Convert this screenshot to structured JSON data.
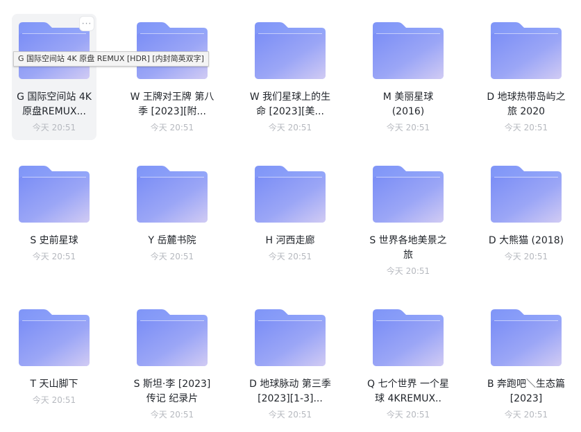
{
  "tooltip": "G 国际空间站 4K 原盘 REMUX [HDR] [内封简英双字]",
  "more_icon": "···",
  "folders": [
    {
      "name": "G 国际空间站 4K 原盘REMUX...",
      "time": "今天 20:51"
    },
    {
      "name": "W 王牌对王牌 第八季 [2023][附...",
      "time": "今天 20:51"
    },
    {
      "name": "W 我们星球上的生命 [2023][美...",
      "time": "今天 20:51"
    },
    {
      "name": "M 美丽星球 (2016)",
      "time": "今天 20:51"
    },
    {
      "name": "D 地球热带岛屿之旅 2020",
      "time": "今天 20:51"
    },
    {
      "name": "S 史前星球",
      "time": "今天 20:51"
    },
    {
      "name": "Y 岳麓书院",
      "time": "今天 20:51"
    },
    {
      "name": "H 河西走廊",
      "time": "今天 20:51"
    },
    {
      "name": "S 世界各地美景之旅",
      "time": "今天 20:51"
    },
    {
      "name": "D 大熊猫 (2018)",
      "time": "今天 20:51"
    },
    {
      "name": "T 天山脚下",
      "time": "今天 20:51"
    },
    {
      "name": "S 斯坦·李 [2023] 传记 纪录片",
      "time": "今天 20:51"
    },
    {
      "name": "D 地球脉动 第三季 [2023][1-3]...",
      "time": "今天 20:51"
    },
    {
      "name": "Q 七个世界 一个星球 4KREMUX..",
      "time": "今天 20:51"
    },
    {
      "name": "B 奔跑吧＼生态篇 [2023]",
      "time": "今天 20:51"
    }
  ]
}
